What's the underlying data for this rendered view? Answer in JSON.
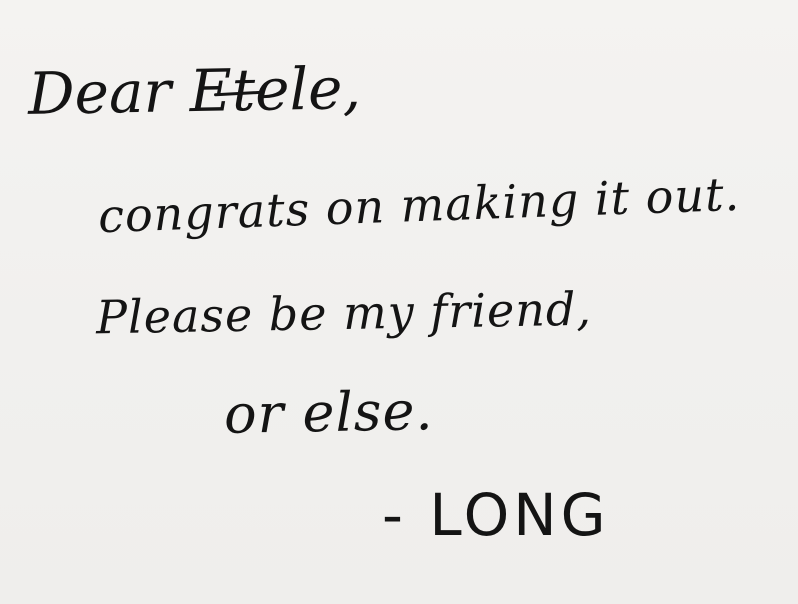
{
  "note": {
    "line1": "Dear Etele,",
    "line2": "congrats on making it out.",
    "line3": "Please be my friend,",
    "line4": "or else.",
    "line5": "- LONG"
  }
}
